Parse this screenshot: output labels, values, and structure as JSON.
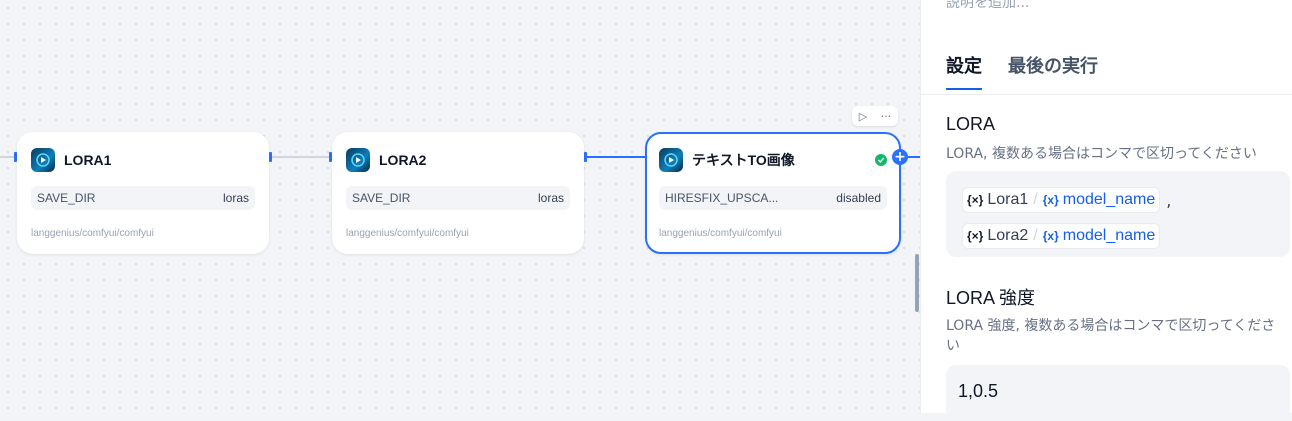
{
  "canvas": {
    "nodes": [
      {
        "title": "LORA1",
        "param_key": "SAVE_DIR",
        "param_value": "loras",
        "footer": "langgenius/comfyui/comfyui"
      },
      {
        "title": "LORA2",
        "param_key": "SAVE_DIR",
        "param_value": "loras",
        "footer": "langgenius/comfyui/comfyui"
      },
      {
        "title": "テキストTO画像",
        "param_key": "HIRESFIX_UPSCA...",
        "param_value": "disabled",
        "footer": "langgenius/comfyui/comfyui"
      }
    ],
    "toolbar": {
      "run_icon": "▷",
      "more_icon": "···"
    },
    "add_icon": "+"
  },
  "panel": {
    "description_placeholder": "説明を追加...",
    "tabs": [
      "設定",
      "最後の実行"
    ],
    "lora": {
      "label": "LORA",
      "description": "LORA, 複数ある場合はコンマで区切ってください",
      "vars": [
        {
          "node": "Lora1",
          "name": "model_name",
          "suffix": ","
        },
        {
          "node": "Lora2",
          "name": "model_name",
          "suffix": ""
        }
      ]
    },
    "lora_strength": {
      "label": "LORA 強度",
      "description": "LORA 強度, 複数ある場合はコンマで区切ってください",
      "value": "1,0.5"
    }
  },
  "colors": {
    "accent": "#2970ff",
    "success": "#12b76a",
    "link": "#155eef"
  }
}
